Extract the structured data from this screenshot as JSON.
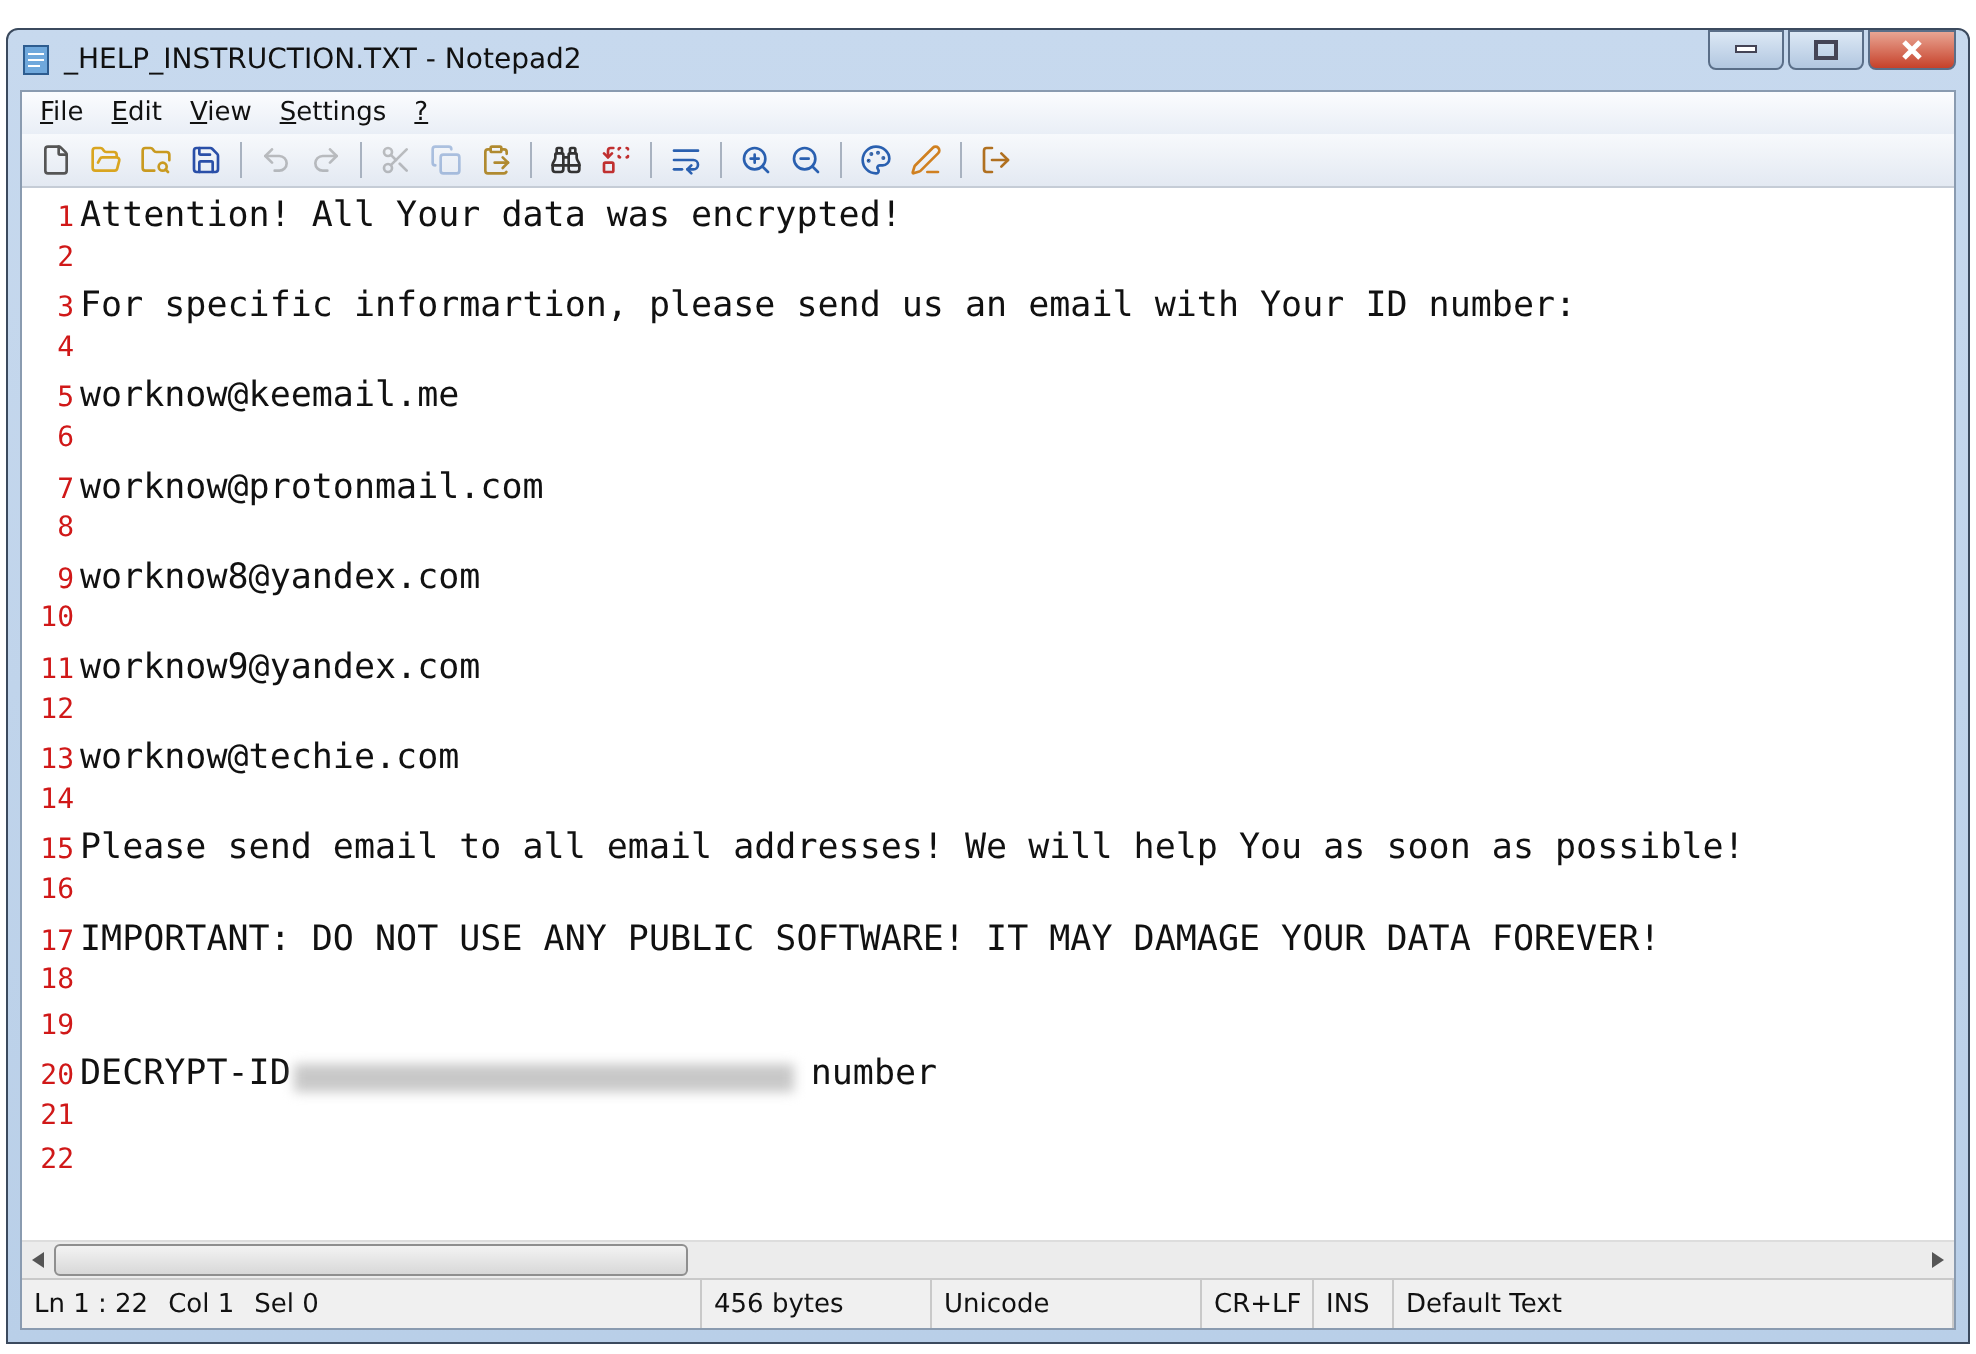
{
  "window": {
    "title": "_HELP_INSTRUCTION.TXT - Notepad2"
  },
  "menu": [
    {
      "label": "File"
    },
    {
      "label": "Edit"
    },
    {
      "label": "View"
    },
    {
      "label": "Settings"
    },
    {
      "label": "?"
    }
  ],
  "toolbar": [
    {
      "kind": "new",
      "disabled": false
    },
    {
      "kind": "open",
      "disabled": false
    },
    {
      "kind": "browse",
      "disabled": false
    },
    {
      "kind": "save",
      "disabled": false
    },
    {
      "kind": "separator"
    },
    {
      "kind": "undo",
      "disabled": true
    },
    {
      "kind": "redo",
      "disabled": true
    },
    {
      "kind": "separator"
    },
    {
      "kind": "cut",
      "disabled": true
    },
    {
      "kind": "copy",
      "disabled": true
    },
    {
      "kind": "paste",
      "disabled": false
    },
    {
      "kind": "separator"
    },
    {
      "kind": "find",
      "disabled": false
    },
    {
      "kind": "replace",
      "disabled": false
    },
    {
      "kind": "separator"
    },
    {
      "kind": "wrap",
      "disabled": false
    },
    {
      "kind": "separator"
    },
    {
      "kind": "zoomin",
      "disabled": false
    },
    {
      "kind": "zoomout",
      "disabled": false
    },
    {
      "kind": "separator"
    },
    {
      "kind": "scheme",
      "disabled": false
    },
    {
      "kind": "config",
      "disabled": false
    },
    {
      "kind": "separator"
    },
    {
      "kind": "exit",
      "disabled": false
    }
  ],
  "lines": [
    {
      "number": "1",
      "text": "Attention! All Your data was encrypted!"
    },
    {
      "number": "2"
    },
    {
      "number": "3",
      "text": "For specific informartion, please send us an email with Your ID number:"
    },
    {
      "number": "4"
    },
    {
      "number": "5",
      "text": "worknow@keemail.me"
    },
    {
      "number": "6"
    },
    {
      "number": "7",
      "text": "worknow@protonmail.com"
    },
    {
      "number": "8"
    },
    {
      "number": "9",
      "text": "worknow8@yandex.com"
    },
    {
      "number": "10"
    },
    {
      "number": "11",
      "text": "worknow9@yandex.com"
    },
    {
      "number": "12"
    },
    {
      "number": "13",
      "text": "worknow@techie.com"
    },
    {
      "number": "14"
    },
    {
      "number": "15",
      "text": "Please send email to all email addresses! We will help You as soon as possible!"
    },
    {
      "number": "16"
    },
    {
      "number": "17",
      "text": "IMPORTANT: DO NOT USE ANY PUBLIC SOFTWARE! IT MAY DAMAGE YOUR DATA FOREVER!"
    },
    {
      "number": "18"
    },
    {
      "number": "19"
    },
    {
      "number": "20",
      "text": "DECRYPT-ID",
      "redacted": true,
      "after": "number"
    },
    {
      "number": "21"
    },
    {
      "number": "22"
    }
  ],
  "status_bar": {
    "position": "Ln 1 : 22",
    "column": "Col 1",
    "selection": "Sel 0",
    "size": "456 bytes",
    "encoding": "Unicode",
    "line_endings": "CR+LF",
    "mode": "INS",
    "scheme": "Default Text"
  }
}
